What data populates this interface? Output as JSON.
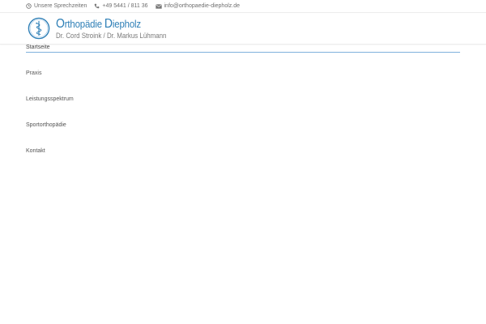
{
  "topbar": {
    "hours": "Unsere Sprechzeiten",
    "phone": "+49 5441 / 811 36",
    "email": "info@orthopaedie-diepholz.de"
  },
  "header": {
    "logo_title_first_letter": "O",
    "logo_title_rest1": "rthopädie ",
    "logo_title_second_letter": "D",
    "logo_title_rest2": "iepholz",
    "logo_subtitle": "Dr. Cord Stroink / Dr. Markus Lühmann"
  },
  "nav": {
    "items": [
      {
        "label": "Startseite"
      },
      {
        "label": "Praxis"
      },
      {
        "label": "Leistungsspektrum"
      },
      {
        "label": "Sportorthopädie"
      },
      {
        "label": "Kontakt"
      }
    ]
  },
  "colors": {
    "brand": "#2e7fb6",
    "active_underline": "#7fb2dc"
  }
}
